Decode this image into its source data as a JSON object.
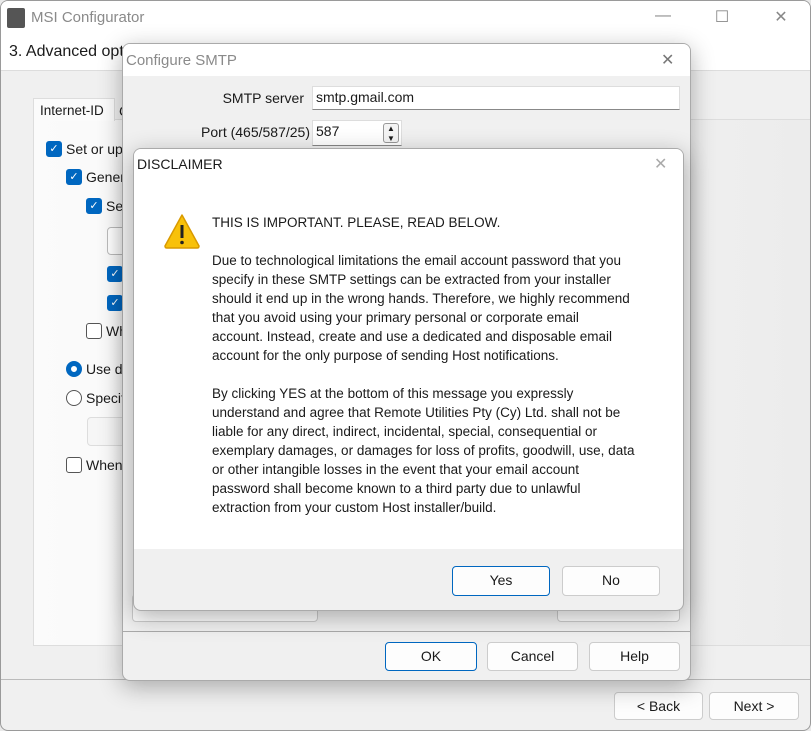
{
  "main_window": {
    "title": "MSI Configurator",
    "step_title": "3. Advanced opt",
    "tab_label": "Internet-ID",
    "tab2_partial": "C",
    "options": [
      {
        "label": "Set or up",
        "checked": true
      },
      {
        "label": "Gener",
        "checked": true
      },
      {
        "label": "Se",
        "checked": true
      },
      {
        "label": "",
        "checked": true
      },
      {
        "label": "",
        "checked": true
      },
      {
        "label": "Wh",
        "checked": false
      }
    ],
    "radios": [
      {
        "label": "Use de",
        "selected": true
      },
      {
        "label": "Specif",
        "selected": false
      }
    ],
    "when_option": {
      "label": "When",
      "checked": false
    },
    "back_button": "< Back",
    "next_button": "Next >"
  },
  "smtp_dialog": {
    "title": "Configure SMTP",
    "server_label": "SMTP server",
    "server_value": "smtp.gmail.com",
    "port_label": "Port (465/587/25)",
    "port_value": "587",
    "ok": "OK",
    "cancel": "Cancel",
    "help": "Help"
  },
  "disclaimer": {
    "title": "DISCLAIMER",
    "heading": "THIS IS IMPORTANT. PLEASE, READ BELOW.",
    "paragraph1": [
      "Due to technological limitations the email account password that you",
      "specify in these SMTP settings can be extracted from your installer",
      "should it end up in the wrong hands. Therefore, we highly recommend",
      "that you avoid using your primary personal or corporate email",
      "account. Instead, create and use a dedicated and disposable email",
      "account for the only purpose of sending Host notifications."
    ],
    "paragraph2": [
      "By clicking YES at the bottom of this message you expressly",
      "understand and agree that Remote Utilities Pty (Cy) Ltd. shall not be",
      "liable for any direct, indirect, incidental, special, consequential or",
      "exemplary damages, or damages for loss of profits, goodwill, use, data",
      "or other intangible losses in the event that your email account",
      "password shall become known to a third party due to unlawful",
      "extraction from your custom Host installer/build."
    ],
    "yes": "Yes",
    "no": "No",
    "icon": "warning-icon"
  }
}
